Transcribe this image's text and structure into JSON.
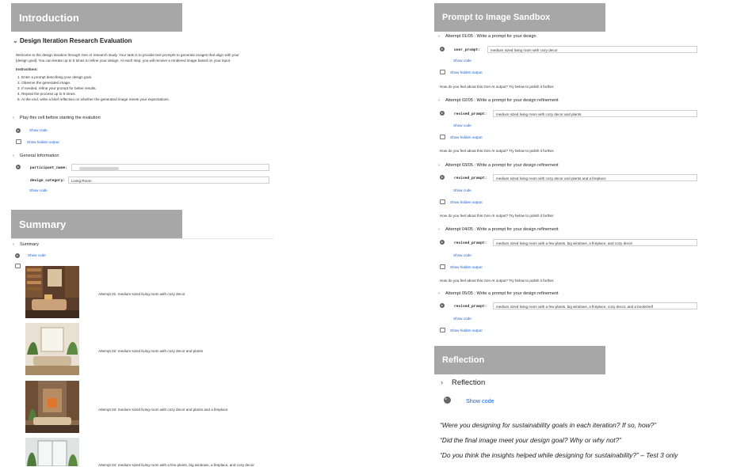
{
  "introduction": {
    "banner": "Introduction",
    "section_title": "Design Iteration Research Evaluation",
    "welcome_line1": "Welcome to the design iteration through Gen AI research study. Your task is to provide text prompts to generate images that align with your",
    "welcome_line2": "[design goal]. You can iterate up to 5 times to refine your design. At each step, you will receive a rendered image based on your input.",
    "instructions_label": "Instructions:",
    "steps": [
      "1. Enter a prompt describing your design goal.",
      "2. Observe the generated image.",
      "3. If needed, refine your prompt for better results.",
      "4. Repeat the process up to 5 times.",
      "5. At the end, write a brief reflection on whether the generated image meets your expectations."
    ],
    "play_cell": "Play this cell before starting the evalution",
    "show_code": "Show code",
    "show_hidden_output": "Show hidden output",
    "general_info": "General Information",
    "participant_label": "participant_name:",
    "participant_value": "",
    "category_label": "design_category:",
    "category_value": "Living Room",
    "show_code_2": "Show code"
  },
  "summary": {
    "banner": "Summary",
    "section_title": "Summary",
    "show_code": "Show code",
    "items": [
      {
        "caption": "Attempt 01: medium sized living room with cozy decor"
      },
      {
        "caption": "Attempt 02: medium sized living room with cozy decor and plants"
      },
      {
        "caption": "Attempt 03: medium sized living room with cozy decor and plants and a fireplace"
      },
      {
        "caption": "Attempt 04: medium sized living room with a few plants, big windows, a fireplace, and cozy decor"
      }
    ]
  },
  "sandbox": {
    "banner": "Prompt to Image Sandbox",
    "show_code": "Show code",
    "show_hidden_output": "Show hidden output",
    "feedback": "How do you feel about this Gen AI output? Try below to polish it further.",
    "attempts": [
      {
        "title": "Attempt 01/05 : Write a prompt for your design",
        "label": "user_prompt:",
        "value": "medium sized living room with cozy decor"
      },
      {
        "title": "Attempt 02/05 : Write a prompt for your design refinement",
        "label": "revised_prompt:",
        "value": "medium sized living room with cozy decor and plants"
      },
      {
        "title": "Attempt 03/05 : Write a prompt for your design refinement",
        "label": "revised_prompt:",
        "value": "medium sized living room with cozy decor and plants and a fireplace"
      },
      {
        "title": "Attempt 04/05 : Write a prompt for your design refinement",
        "label": "revised_prompt:",
        "value": "medium sized living room with a few plants, big windows, a fireplace, and cozy decor"
      },
      {
        "title": "Attempt 05/05 : Write a prompt for your design refinement",
        "label": "revised_prompt:",
        "value": "medium sized living room with a few plants, big windows, a fireplace, cozy decor, and a bookshelf"
      }
    ]
  },
  "reflection": {
    "banner": "Reflection",
    "section_title": "Reflection",
    "show_code": "Show code",
    "questions": [
      "“Were you designing for sustainability goals in each iteration? If so, how?”",
      "“Did the final image meet your design goal? Why or why not?”",
      "“Do you think the insights helped while designing for sustainability?” – Test 3 only"
    ]
  },
  "colors": {
    "banner": "#a7a7a7",
    "link": "#1a5fd0"
  }
}
